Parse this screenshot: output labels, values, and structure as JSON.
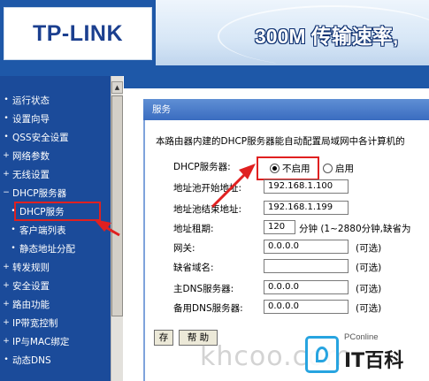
{
  "banner": {
    "logo": "TP-LINK",
    "slogan": "300M 传输速率,"
  },
  "sidebar": {
    "items": [
      {
        "label": "运行状态",
        "bullet": "•"
      },
      {
        "label": "设置向导",
        "bullet": "•"
      },
      {
        "label": "QSS安全设置",
        "bullet": "•"
      },
      {
        "label": "网络参数",
        "bullet": "+"
      },
      {
        "label": "无线设置",
        "bullet": "+"
      },
      {
        "label": "DHCP服务器",
        "bullet": "−"
      },
      {
        "label": "DHCP服务",
        "bullet": "•"
      },
      {
        "label": "客户端列表",
        "bullet": "•"
      },
      {
        "label": "静态地址分配",
        "bullet": "•"
      },
      {
        "label": "转发规则",
        "bullet": "+"
      },
      {
        "label": "安全设置",
        "bullet": "+"
      },
      {
        "label": "路由功能",
        "bullet": "+"
      },
      {
        "label": "IP带宽控制",
        "bullet": "+"
      },
      {
        "label": "IP与MAC绑定",
        "bullet": "+"
      },
      {
        "label": "动态DNS",
        "bullet": "•"
      }
    ],
    "selected": "DHCP服务"
  },
  "panel": {
    "title": "服务",
    "intro": "本路由器内建的DHCP服务器能自动配置局域网中各计算机的",
    "dhcp_server_label": "DHCP服务器:",
    "radio_disable": "不启用",
    "radio_enable": "启用",
    "radio_selected": "不启用",
    "pool_start_label": "地址池开始地址:",
    "pool_start_value": "192.168.1.100",
    "pool_end_label": "地址池结束地址:",
    "pool_end_value": "192.168.1.199",
    "lease_label": "地址租期:",
    "lease_value": "120",
    "lease_suffix": "分钟 (1~2880分钟,缺省为",
    "gateway_label": "网关:",
    "gateway_value": "0.0.0.0",
    "gateway_hint": "(可选)",
    "domain_label": "缺省域名:",
    "domain_value": "",
    "domain_hint": "(可选)",
    "dns1_label": "主DNS服务器:",
    "dns1_value": "0.0.0.0",
    "dns1_hint": "(可选)",
    "dns2_label": "备用DNS服务器:",
    "dns2_value": "0.0.0.0",
    "dns2_hint": "(可选)",
    "save_button": "存",
    "help_button": "帮 助"
  },
  "watermark": {
    "site": "khcoo.com",
    "badge_small": "PConline",
    "badge_brand": "IT百科"
  },
  "colors": {
    "sidebar_bg": "#1b4b9a",
    "highlight_red": "#e02020",
    "panel_title_bg": "#3a6cc0"
  }
}
